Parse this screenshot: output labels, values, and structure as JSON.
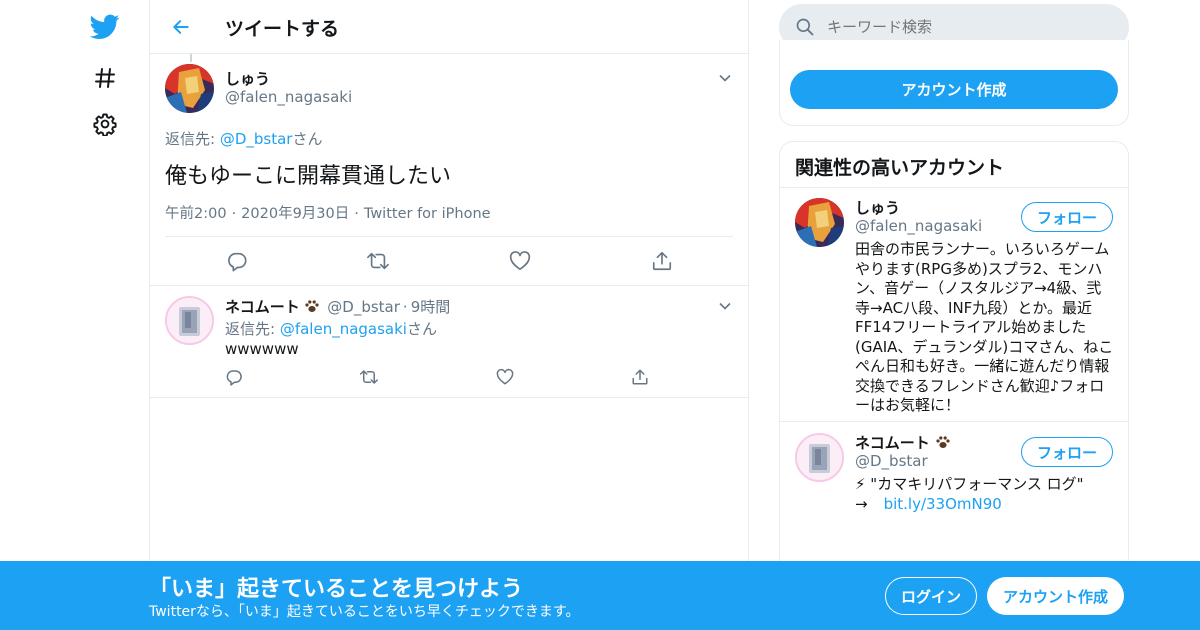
{
  "nav": {
    "items": [
      {
        "icon": "twitter-bird-icon"
      },
      {
        "icon": "hashtag-icon"
      },
      {
        "icon": "gear-icon"
      }
    ]
  },
  "header": {
    "title": "ツイートする"
  },
  "tweet": {
    "name": "しゅう",
    "handle": "@falen_nagasaki",
    "reply_prefix": "返信先: ",
    "reply_to": "@D_bstar",
    "reply_suffix": "さん",
    "text": "俺もゆーこに開幕貫通したい",
    "time": "午前2:00",
    "date": "2020年9月30日",
    "source": "Twitter for iPhone"
  },
  "reply": {
    "name": "ネコムート",
    "handle": "@D_bstar",
    "age": "9時間",
    "reply_prefix": "返信先: ",
    "reply_to": "@falen_nagasaki",
    "reply_suffix": "さん",
    "text": "wwwwww"
  },
  "search": {
    "placeholder": "キーワード検索"
  },
  "signup_card": {
    "button": "アカウント作成"
  },
  "related": {
    "title": "関連性の高いアカウント",
    "follow_label": "フォロー",
    "accounts": [
      {
        "name": "しゅう",
        "handle": "@falen_nagasaki",
        "bio_lines": [
          "田舎の市民ランナー。いろいろゲーム",
          "やります(RPG多め)スプラ2、モンハ",
          "ン、音ゲー（ノスタルジア→4級、弐",
          "寺→AC八段、INF九段）とか。最近",
          "FF14フリートライアル始めました",
          "(GAIA、デュランダル)コマさん、ねこ",
          "ぺん日和も好き。一緒に遊んだり情報",
          "交換できるフレンドさん歓迎♪フォロ",
          "ーはお気軽に！"
        ]
      },
      {
        "name": "ネコムート",
        "handle": "@D_bstar",
        "bio_line1": "⚡ \"カマキリパフォーマンス ログ\"",
        "bio_arrow": "→",
        "bio_link": "bit.ly/33OmN90"
      }
    ]
  },
  "banner": {
    "headline": "「いま」起きていることを見つけよう",
    "subline": "Twitterなら、「いま」起きていることをいち早くチェックできます。",
    "login": "ログイン",
    "signup": "アカウント作成"
  },
  "colors": {
    "accent": "#1da1f2",
    "secondary_text": "#657786",
    "border": "#e6ecf0",
    "search_bg": "#e6ecf0"
  }
}
